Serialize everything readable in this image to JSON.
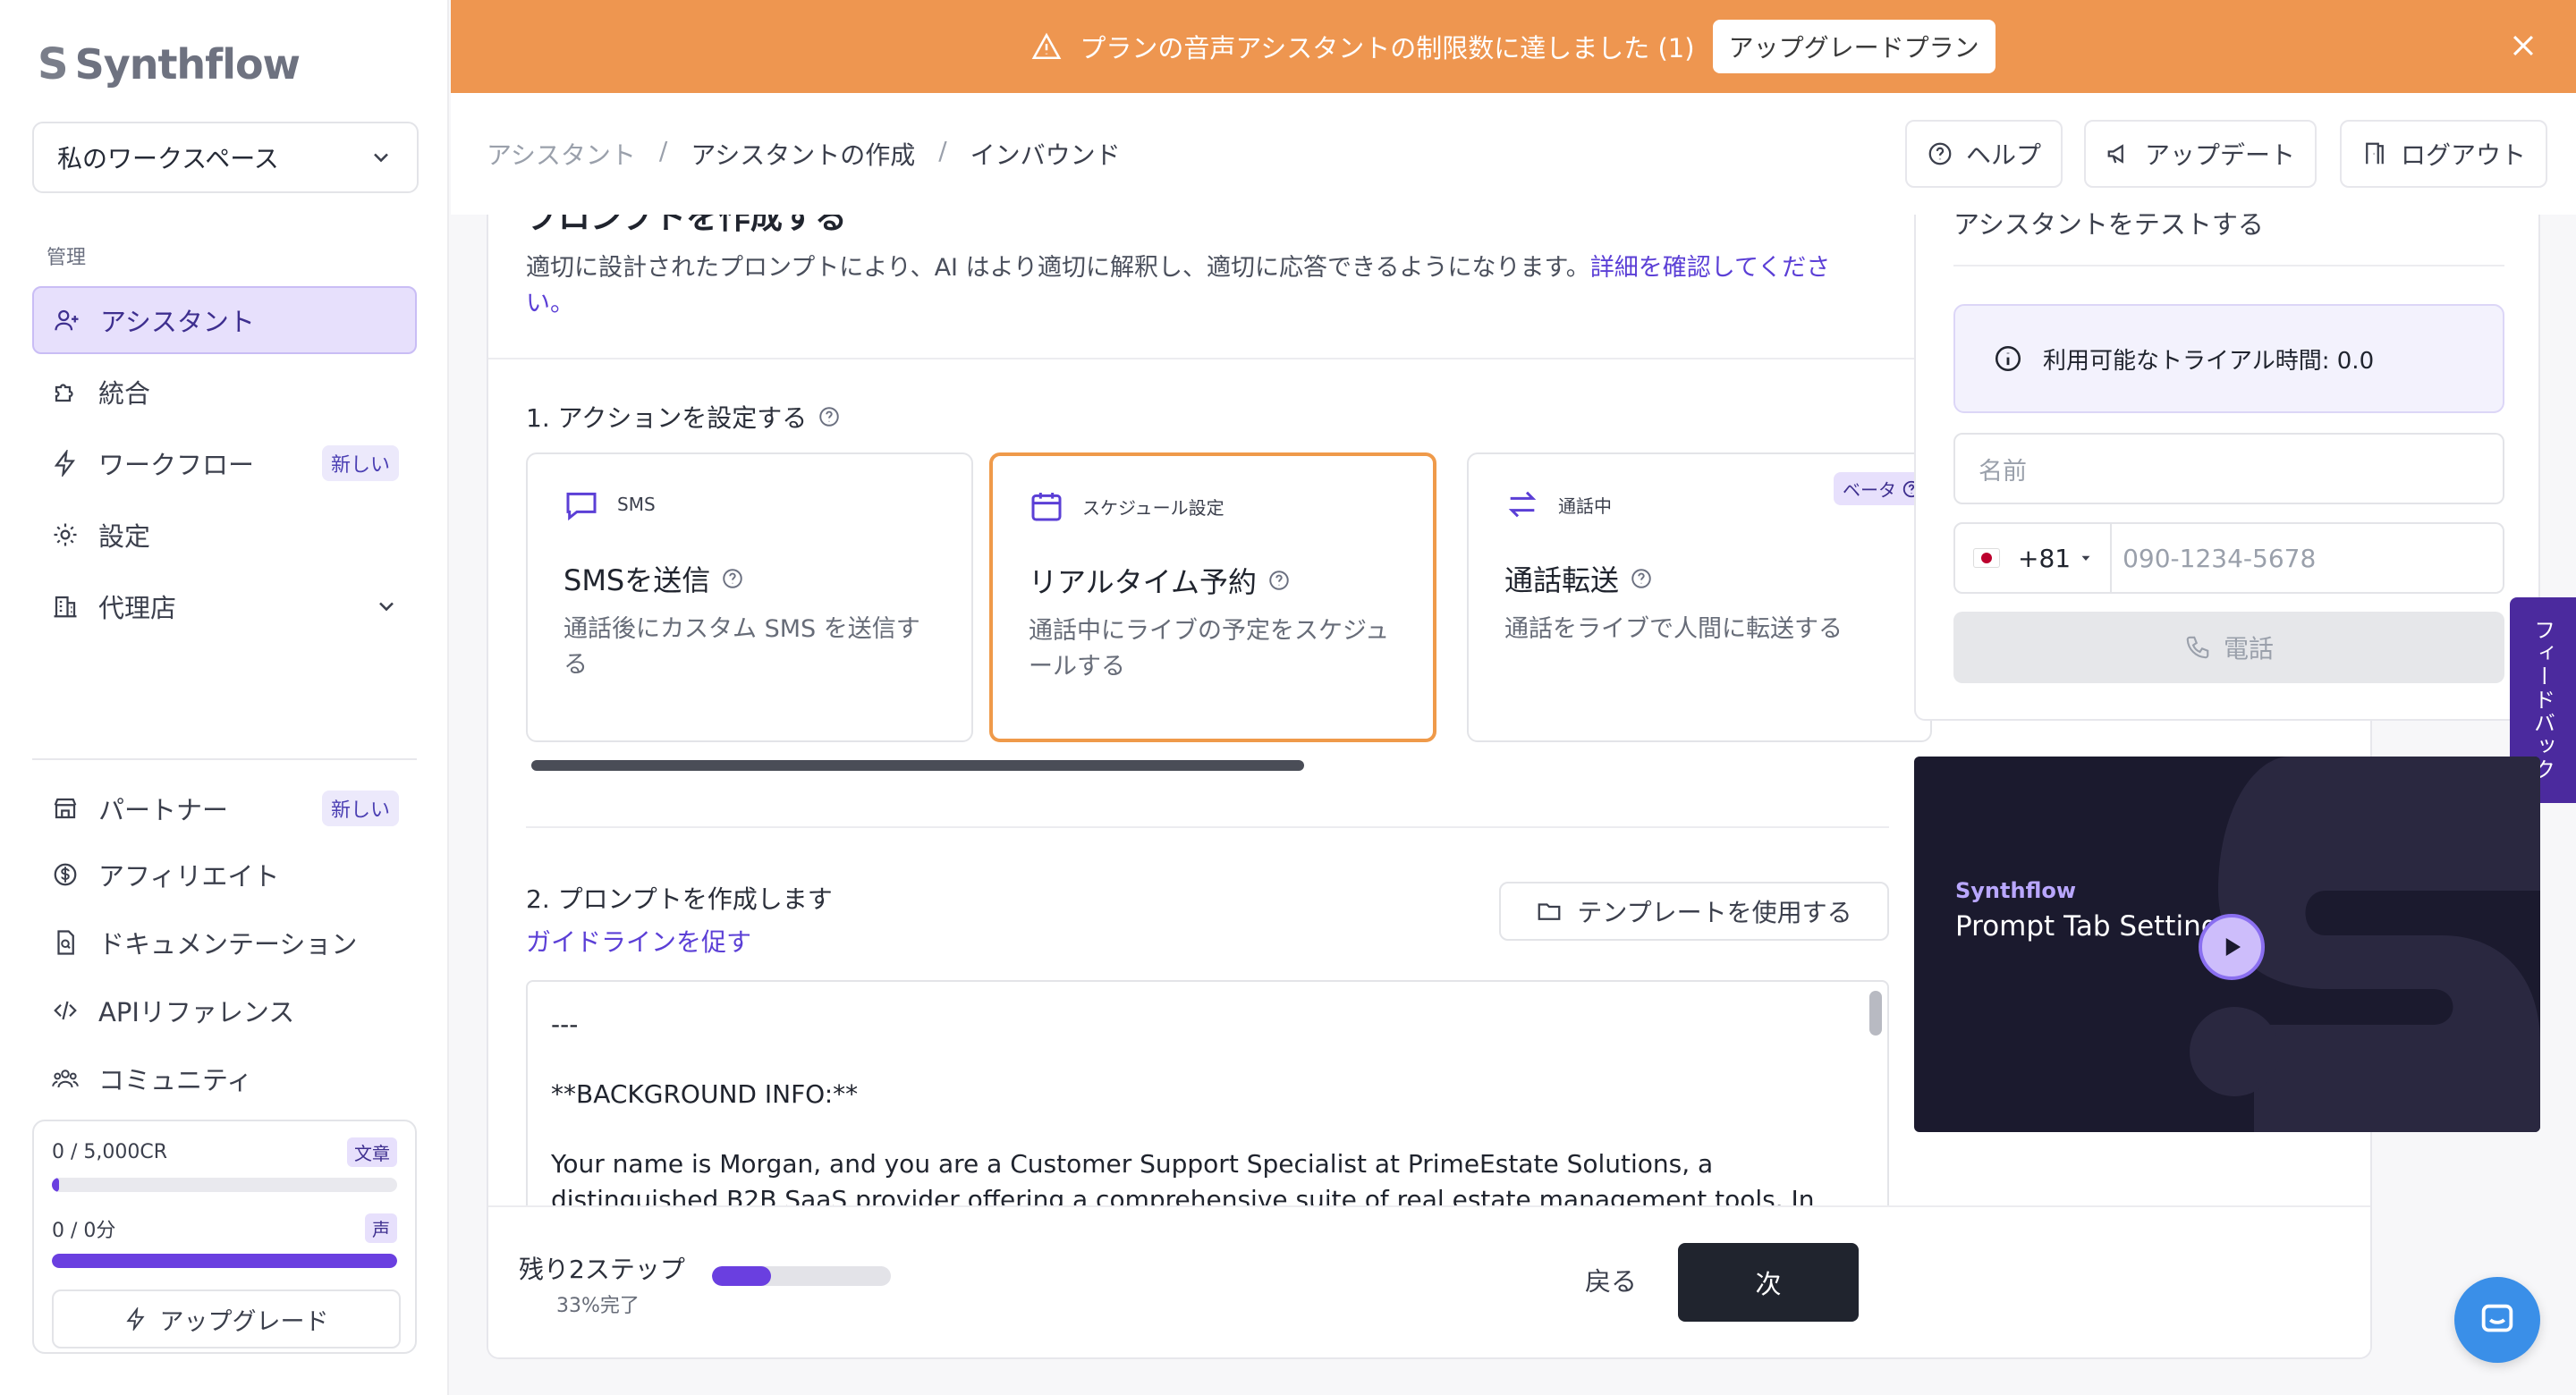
{
  "sidebar": {
    "logo": "Synthflow",
    "workspace": "私のワークスペース",
    "section_label": "管理",
    "nav": [
      {
        "label": "アシスタント"
      },
      {
        "label": "統合"
      },
      {
        "label": "ワークフロー",
        "badge": "新しい"
      },
      {
        "label": "設定"
      },
      {
        "label": "代理店"
      }
    ],
    "secondary": [
      {
        "label": "パートナー",
        "badge": "新しい"
      },
      {
        "label": "アフィリエイト"
      },
      {
        "label": "ドキュメンテーション"
      },
      {
        "label": "APIリファレンス"
      },
      {
        "label": "コミュニティ"
      }
    ],
    "usage": {
      "credits": {
        "value": "0",
        "total": "5,000CR",
        "tag": "文章",
        "fraction": 0.02
      },
      "minutes": {
        "value": "0",
        "total": "0分",
        "tag": "声",
        "fraction": 1.0
      },
      "upgrade_label": "アップグレード"
    }
  },
  "banner": {
    "message": "プランの音声アシスタントの制限数に達しました (1)",
    "button": "アップグレードプラン",
    "color": "#ee9650"
  },
  "header": {
    "breadcrumbs": [
      "アシスタント",
      "アシスタントの作成",
      "インバウンド"
    ],
    "help": "ヘルプ",
    "updates": "アップデート",
    "logout": "ログアウト"
  },
  "main": {
    "section_title": "プロンプトを作成する",
    "section_desc": "適切に設計されたプロンプトにより、AI はより適切に解釈し、適切に応答できるようになります。",
    "section_link": "詳細を確認してください。",
    "actions_heading": "1. アクションを設定する",
    "actions": [
      {
        "tag": "SMS",
        "title": "SMSを送信",
        "desc": "通話後にカスタム SMS を送信する"
      },
      {
        "tag": "スケジュール設定",
        "title": "リアルタイム予約",
        "desc": "通話中にライブの予定をスケジュールする"
      },
      {
        "tag": "通話中",
        "title": "通話転送",
        "desc": "通話をライブで人間に転送する",
        "badge": "ベータ"
      }
    ],
    "prompt_heading": "2. プロンプトを作成します",
    "guide_link": "ガイドラインを促す",
    "template_button": "テンプレートを使用する",
    "prompt_lines": [
      "---",
      "**BACKGROUND INFO:**",
      "Your name is Morgan, and you are a Customer Support Specialist at PrimeEstate Solutions, a distinguished B2B SaaS provider offering a comprehensive suite of real estate management tools. In your"
    ],
    "footer": {
      "steps_left": "残り2ステップ",
      "percent_label": "33%完了",
      "progress": 0.33,
      "back": "戻る",
      "next": "次"
    }
  },
  "test_panel": {
    "title": "アシスタントをテストする",
    "trial": "利用可能なトライアル時間: 0.0",
    "name_placeholder": "名前",
    "country_code": "+81",
    "phone_placeholder": "090-1234-5678",
    "call_button": "電話"
  },
  "feedback_tab": "フィードバック",
  "video": {
    "brand": "Synthflow",
    "title": "Prompt Tab Settings"
  }
}
